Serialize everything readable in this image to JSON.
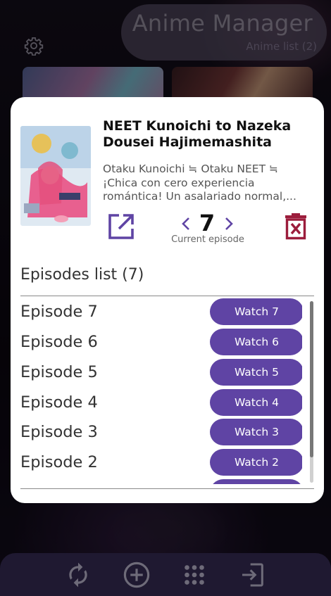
{
  "app": {
    "title": "Anime Manager",
    "subtitle": "Anime list (2)"
  },
  "icons": {
    "settings": "gear-icon",
    "refresh": "refresh-icon",
    "add": "add-circle-icon",
    "grid": "apps-grid-icon",
    "login": "login-icon",
    "open": "open-external-icon",
    "prev": "chevron-left-icon",
    "next": "chevron-right-icon",
    "delete": "delete-icon"
  },
  "colors": {
    "accent": "#5f44a4",
    "delete": "#9c1d3c",
    "bottom_bar": "#3a2f5a"
  },
  "detail": {
    "title": "NEET Kunoichi to Nazeka Dousei Hajimemashita",
    "description": "Otaku Kunoichi ≒ Otaku NEET ≒ ¡Chica con cero experiencia romántica! Un asalariado normal,...",
    "current_episode": "7",
    "current_episode_caption": "Current episode"
  },
  "episodes": {
    "heading": "Episodes list (7)",
    "items": [
      {
        "label": "Episode 7",
        "button": "Watch 7"
      },
      {
        "label": "Episode 6",
        "button": "Watch 6"
      },
      {
        "label": "Episode 5",
        "button": "Watch 5"
      },
      {
        "label": "Episode 4",
        "button": "Watch 4"
      },
      {
        "label": "Episode 3",
        "button": "Watch 3"
      },
      {
        "label": "Episode 2",
        "button": "Watch 2"
      }
    ],
    "scroll_fraction": 0.86
  }
}
